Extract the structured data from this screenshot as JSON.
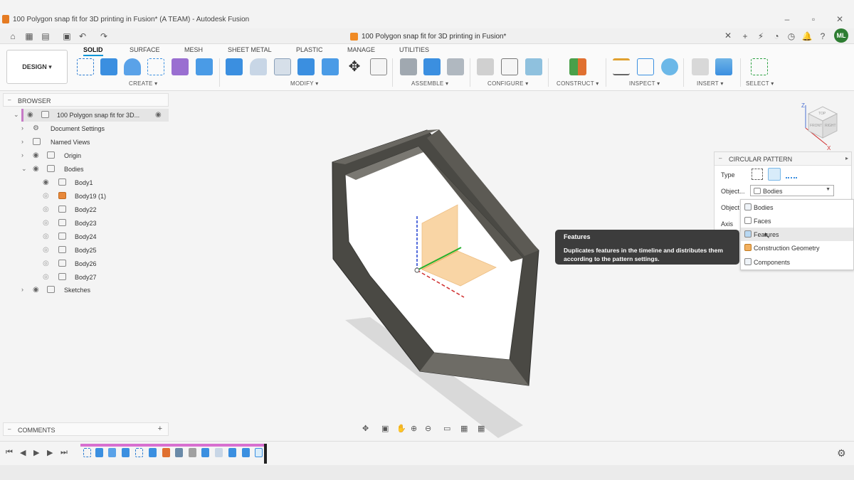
{
  "window": {
    "title": "100 Polygon snap fit for 3D printing in Fusion* (A TEAM) - Autodesk Fusion"
  },
  "document_tab": {
    "title": "100 Polygon snap fit for 3D printing in Fusion*"
  },
  "user": {
    "initials": "ML"
  },
  "toolbar": {
    "workspace": "DESIGN",
    "tabs": [
      "SOLID",
      "SURFACE",
      "MESH",
      "SHEET METAL",
      "PLASTIC",
      "MANAGE",
      "UTILITIES"
    ],
    "active_tab": "SOLID",
    "groups": [
      "CREATE",
      "MODIFY",
      "ASSEMBLE",
      "CONFIGURE",
      "CONSTRUCT",
      "INSPECT",
      "INSERT",
      "SELECT"
    ]
  },
  "browser": {
    "title": "BROWSER",
    "root": "100 Polygon snap fit for 3D...",
    "items": [
      {
        "label": "Document Settings"
      },
      {
        "label": "Named Views"
      },
      {
        "label": "Origin"
      },
      {
        "label": "Bodies"
      },
      {
        "label": "Body1"
      },
      {
        "label": "Body19 (1)"
      },
      {
        "label": "Body22"
      },
      {
        "label": "Body23"
      },
      {
        "label": "Body24"
      },
      {
        "label": "Body25"
      },
      {
        "label": "Body26"
      },
      {
        "label": "Body27"
      },
      {
        "label": "Sketches"
      }
    ]
  },
  "comments": {
    "title": "COMMENTS"
  },
  "circular_pattern": {
    "title": "CIRCULAR PATTERN",
    "type_label": "Type",
    "object_type_label": "Object...",
    "objects_label": "Object",
    "axis_label": "Axis",
    "selected": "Bodies",
    "options": [
      "Bodies",
      "Faces",
      "Features",
      "Construction Geometry",
      "Components"
    ]
  },
  "tooltip": {
    "title": "Features",
    "description": "Duplicates features in the timeline and distributes them according to the pattern settings."
  },
  "viewcube": {
    "front": "FRONT",
    "right": "RIGHT",
    "top": "TOP",
    "z": "Z",
    "x": "X"
  },
  "colors": {
    "accent": "#0696d7",
    "timeline_bar": "#d770d0",
    "body": "#55534d",
    "tooltip_bg": "#3c3c3c"
  }
}
